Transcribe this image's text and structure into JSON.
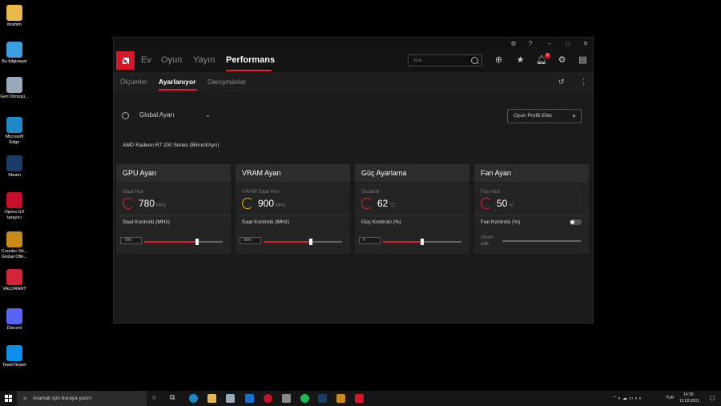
{
  "desktop": {
    "icons": [
      {
        "label": "ibrahim",
        "color": "#e8b84a"
      },
      {
        "label": "Bu bilgisayar",
        "color": "#3aa0e0"
      },
      {
        "label": "Geri Dönüşü...",
        "color": "#9ab"
      },
      {
        "label": "Microsoft Edge",
        "color": "#1e88c8"
      },
      {
        "label": "Steam",
        "color": "#1b3c66"
      },
      {
        "label": "Opera GX tarayıcı",
        "color": "#c4102a"
      },
      {
        "label": "Counter-Str... Global Offe...",
        "color": "#c88a1a"
      },
      {
        "label": "VALORANT",
        "color": "#d2253a"
      },
      {
        "label": "Discord",
        "color": "#5865f2"
      },
      {
        "label": "TeamViewer",
        "color": "#0e8ee9"
      }
    ]
  },
  "app": {
    "nav": {
      "home": "Ev",
      "game": "Oyun",
      "stream": "Yayın",
      "performance": "Performans"
    },
    "search_placeholder": "Ara",
    "notification_count": "2",
    "subnav": {
      "metrics": "Ölçümler",
      "tuning": "Ayarlanıyor",
      "advisors": "Danışmanlar"
    },
    "profile": {
      "label": "Global Ayarı",
      "add_game_profile": "Oyun Profili Ekle"
    },
    "gpu_name": "AMD Radeon R7 200 Series (Birincil/Ayrı)",
    "accent": "#e21d2c",
    "cards": {
      "gpu": {
        "title": "GPU Ayarı",
        "label": "Saat Hızı",
        "value": "780",
        "unit": "MHz",
        "control": "Saat Kontrolü (MHz)",
        "input": "780",
        "level": 0.67
      },
      "vram": {
        "title": "VRAM Ayarı",
        "label": "VRAM Saat Hızı",
        "value": "900",
        "unit": "MHz",
        "control": "Saat Kontrolü (MHz)",
        "input": "900",
        "level": 0.6
      },
      "power": {
        "title": "Güç Ayarlama",
        "label": "Sıcaklık",
        "value": "62",
        "unit": "°C",
        "control": "Güç Kontrolü (%)",
        "input": "0",
        "level": 0.5
      },
      "fan": {
        "title": "Fan Ayarı",
        "label": "Fan Hızı",
        "value": "50",
        "unit": "%",
        "control": "Fan Kontrolü (%)",
        "auto": "Otom atik"
      }
    }
  },
  "taskbar": {
    "search_placeholder": "Aramak için buraya yazın",
    "lang": "TUR",
    "time": "14:39",
    "date": "13.03.2021"
  }
}
